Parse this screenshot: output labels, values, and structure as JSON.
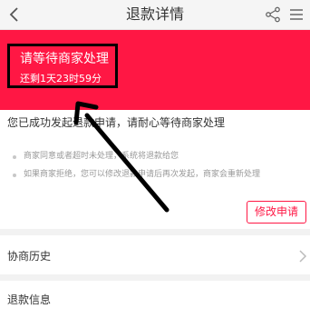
{
  "header": {
    "title": "退款详情",
    "icons": [
      "back-icon",
      "share-icon",
      "more-icon"
    ]
  },
  "banner": {
    "title": "请等待商家处理",
    "countdown": "还剩1天23时59分",
    "color": "#ff1744"
  },
  "status": {
    "message": "您已成功发起退款申请，请耐心等待商家处理",
    "notes": [
      "商家同意或者超时未处理，系统将退款给您",
      "如果商家拒绝，您可以修改退款申请后再次发起，商家会重新处理"
    ]
  },
  "actions": {
    "modify_label": "修改申请"
  },
  "sections": {
    "history_label": "协商历史",
    "refund_info_label": "退款信息"
  }
}
